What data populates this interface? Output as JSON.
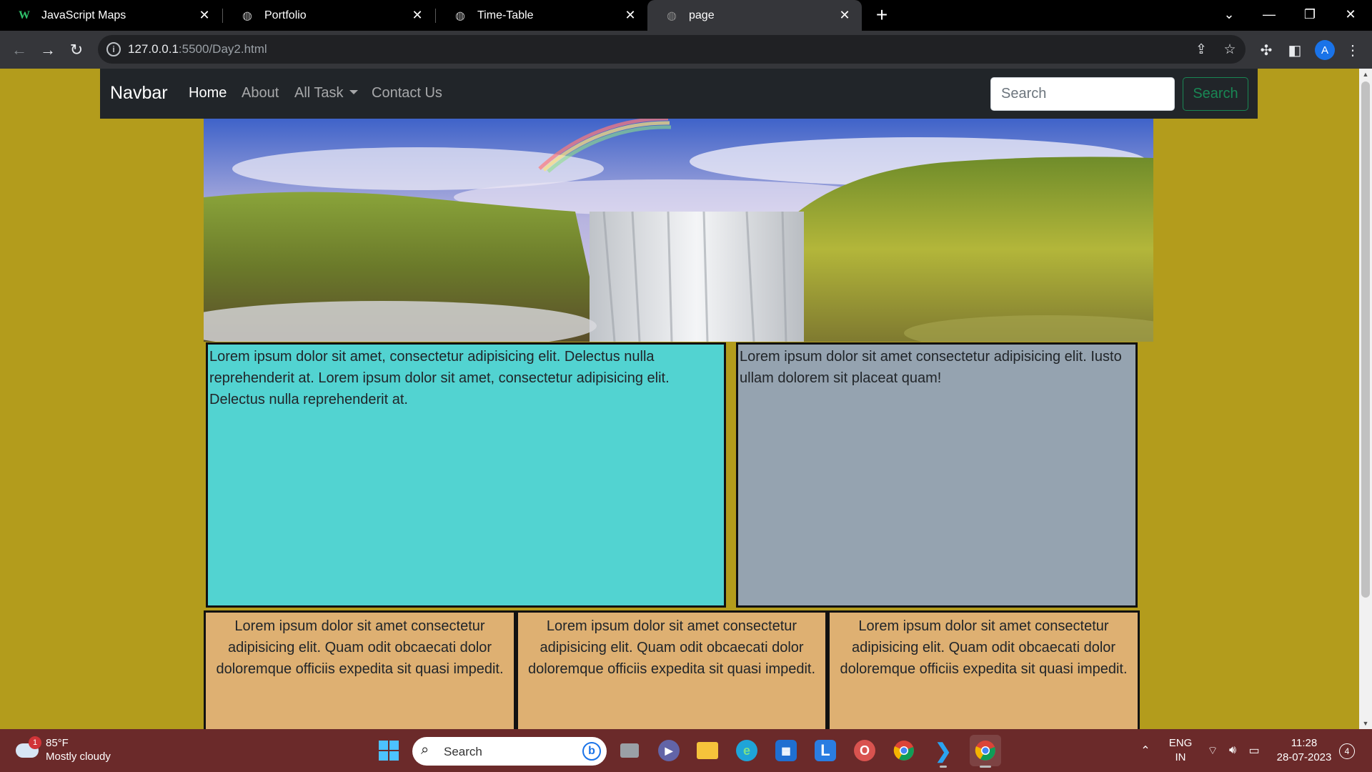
{
  "browser": {
    "tabs": [
      {
        "title": "JavaScript Maps",
        "icon": "w-logo-icon",
        "active": false
      },
      {
        "title": "Portfolio",
        "icon": "globe-icon",
        "active": false
      },
      {
        "title": "Time-Table",
        "icon": "globe-icon",
        "active": false
      },
      {
        "title": "page",
        "icon": "globe-icon",
        "active": true
      }
    ],
    "url_host": "127.0.0.1",
    "url_rest": ":5500/Day2.html",
    "profile_initial": "A"
  },
  "page": {
    "navbar": {
      "brand": "Navbar",
      "links": [
        "Home",
        "About",
        "All Task",
        "Contact Us"
      ],
      "search_placeholder": "Search",
      "search_button": "Search"
    },
    "hero_alt": "waterfall with rainbow",
    "boxes": {
      "cyan_text": "Lorem ipsum dolor sit amet, consectetur adipisicing elit. Delectus nulla reprehenderit at. Lorem ipsum dolor sit amet, consectetur adipisicing elit. Delectus nulla reprehenderit at.",
      "gray_text": "Lorem ipsum dolor sit amet consectetur adipisicing elit. Iusto ullam dolorem sit placeat quam!",
      "tan_texts": [
        "Lorem ipsum dolor sit amet consectetur adipisicing elit. Quam odit obcaecati dolor doloremque officiis expedita sit quasi impedit.",
        "Lorem ipsum dolor sit amet consectetur adipisicing elit. Quam odit obcaecati dolor doloremque officiis expedita sit quasi impedit.",
        "Lorem ipsum dolor sit amet consectetur adipisicing elit. Quam odit obcaecati dolor doloremque officiis expedita sit quasi impedit."
      ]
    },
    "colors": {
      "page_bg": "#b39c1c",
      "cyan_box": "#52d3d1",
      "gray_box": "#95a3b0",
      "tan_box": "#deb072",
      "navbar": "#212529"
    }
  },
  "taskbar": {
    "weather_badge": "1",
    "weather_temp": "85°F",
    "weather_condition": "Mostly cloudy",
    "search_placeholder": "Search",
    "lang_top": "ENG",
    "lang_bottom": "IN",
    "time": "11:28",
    "date": "28-07-2023",
    "notification_count": "4",
    "apps": [
      "windows-start-icon",
      "task-view-icon",
      "teams-chat-icon",
      "file-explorer-icon",
      "edge-icon",
      "store-icon",
      "l-app-icon",
      "opera-icon",
      "chrome-icon",
      "vscode-icon",
      "chrome-profile-icon"
    ]
  }
}
